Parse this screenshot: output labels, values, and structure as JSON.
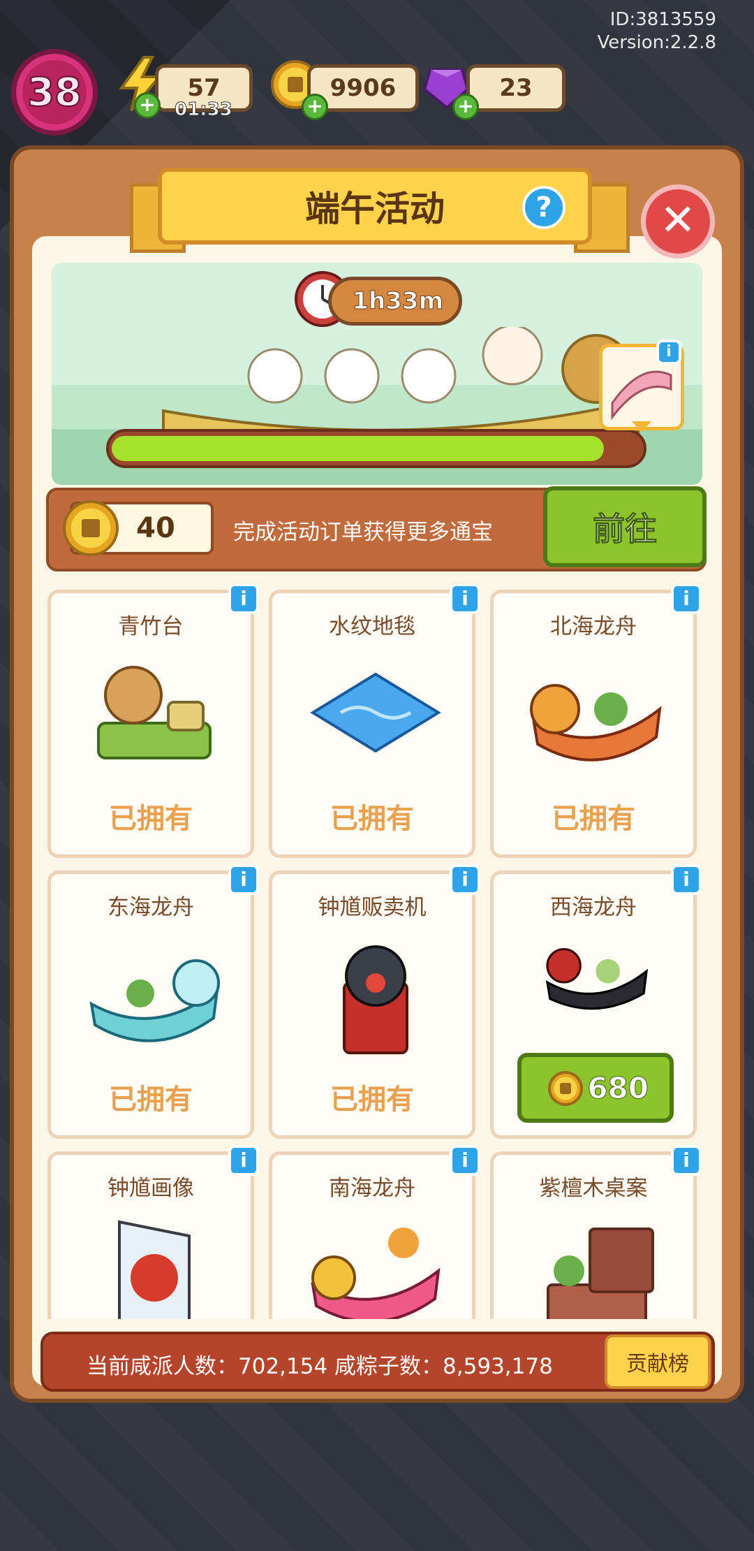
{
  "meta": {
    "id_label": "ID:3813559",
    "version_label": "Version:2.2.8"
  },
  "hud": {
    "level": "38",
    "energy": "57",
    "energy_timer": "01:33",
    "coins": "9906",
    "gems": "23"
  },
  "dialog": {
    "title": "端午活动",
    "help_icon": "question-icon",
    "close_icon": "close-icon"
  },
  "event": {
    "time_left": "1h33m",
    "progress": 0.94
  },
  "tokens": {
    "count": "40",
    "hint": "完成活动订单获得更多通宝",
    "go_label": "前往"
  },
  "items": [
    {
      "name": "青竹台",
      "status": "已拥有"
    },
    {
      "name": "水纹地毯",
      "status": "已拥有"
    },
    {
      "name": "北海龙舟",
      "status": "已拥有"
    },
    {
      "name": "东海龙舟",
      "status": "已拥有"
    },
    {
      "name": "钟馗贩卖机",
      "status": "已拥有"
    },
    {
      "name": "西海龙舟",
      "price": "680"
    },
    {
      "name": "钟馗画像"
    },
    {
      "name": "南海龙舟"
    },
    {
      "name": "紫檀木桌案"
    }
  ],
  "footer": {
    "stats": "当前咸派人数：702,154   咸粽子数：8,593,178",
    "rank_label": "贡献榜"
  },
  "colors": {
    "panel": "#c7814a",
    "banner": "#ffd24c",
    "go_button": "#8ec42b",
    "progress": "#a6e12c",
    "owned_text": "#e9a04f"
  }
}
